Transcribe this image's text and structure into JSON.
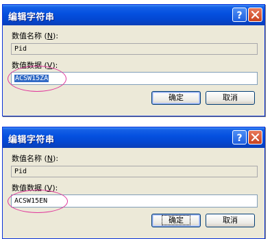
{
  "dialogs": [
    {
      "title": "编辑字符串",
      "name_label_prefix": "数值名称 (",
      "name_label_key": "N",
      "name_label_suffix": "):",
      "name_value": "Pid",
      "data_label_prefix": "数值数据 (",
      "data_label_key": "V",
      "data_label_suffix": "):",
      "data_value": "ACSW15ZA",
      "ok_label": "确定",
      "cancel_label": "取消"
    },
    {
      "title": "编辑字符串",
      "name_label_prefix": "数值名称 (",
      "name_label_key": "N",
      "name_label_suffix": "):",
      "name_value": "Pid",
      "data_label_prefix": "数值数据 (",
      "data_label_key": "V",
      "data_label_suffix": "):",
      "data_value": "ACSW15EN",
      "ok_label": "确定",
      "cancel_label": "取消"
    }
  ],
  "icons": {
    "help": "help-icon",
    "close": "close-icon"
  },
  "colors": {
    "titlebar": "#0551e0",
    "dialog_bg": "#ece9d8",
    "selection": "#316ac5",
    "highlight_ellipse": "#e0349a"
  }
}
